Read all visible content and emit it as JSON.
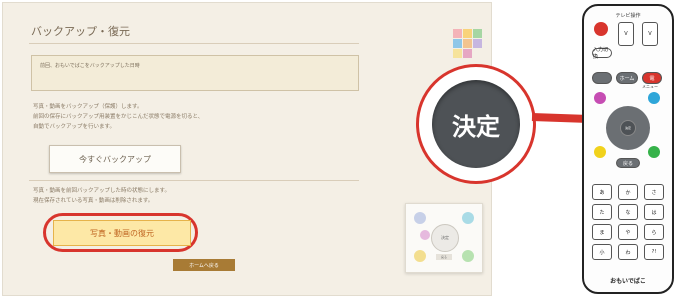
{
  "screen": {
    "title": "バックアップ・復元",
    "info_text": "前回、おもいでばこをバックアップした日時",
    "backup_desc": [
      "写真・動画をバックアップ（保護）します。",
      "前回の保存にバックアップ用装置をかじこんだ状態で電源を切ると、",
      "自動でバックアップを行います。"
    ],
    "backup_now_label": "今すぐバックアップ",
    "restore_desc": [
      "写真・動画を前回バックアップした時の状態にします。",
      "現在保存されている写真・動画は削除されます。"
    ],
    "restore_label": "写真・動画の復元",
    "back_label": "ホームへ戻る",
    "pad_center_label": "決定",
    "pad_mini_label": "戻る"
  },
  "zoom": {
    "label": "決定"
  },
  "remote": {
    "top_label": "テレビ操作",
    "brand": "おもいでばこ",
    "center_label": "決定",
    "vol_label": "V",
    "ch_label": "V",
    "input_label": "入力切換",
    "power_label": "電",
    "menu_label": "メニュー",
    "home_label": "ホーム",
    "back_label": "戻る",
    "num_keys": [
      "あ",
      "か",
      "さ",
      "た",
      "な",
      "は",
      "ま",
      "や",
      "ら",
      "小",
      "わ",
      "?!"
    ]
  },
  "colors": {
    "highlight": "#d8352d",
    "restore_fill": "#fde8a6",
    "back_fill": "#a87b35",
    "pad_dark": "#4e5256"
  }
}
